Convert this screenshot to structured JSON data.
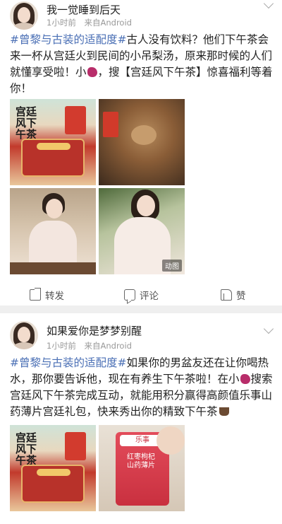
{
  "posts": [
    {
      "username": "我一觉睡到后天",
      "time": "1小时前",
      "source": "来自Android",
      "text": {
        "hashtag": "#曾黎与古装的适配度#",
        "line_a": "古人没有饮料？他们下午茶会来一杯从宫廷火到民间的小吊梨汤，原来那时候的人们就懂享受啦！小",
        "line_b": "，搜【宫廷风下午茶】惊喜福利等着你！"
      },
      "images": [
        {
          "kind": "poster",
          "caption": "宫廷风下午茶"
        },
        {
          "kind": "teaset"
        },
        {
          "kind": "woman"
        },
        {
          "kind": "woman2",
          "badge": "动图"
        }
      ],
      "actions": {
        "repost": "转发",
        "comment": "评论",
        "like": "赞"
      }
    },
    {
      "username": "如果爱你是梦梦别醒",
      "time": "1小时前",
      "source": "来自Android",
      "text": {
        "hashtag": "#曾黎与古装的适配度#",
        "line_a": "如果你的男盆友还在让你喝热水，那你要告诉他，现在有养生下午茶啦！在小",
        "line_b": "搜索宫廷风下午茶完成互动，就能用积分赢得高颜值乐事山药薄片宫廷礼包，快来秀出你的精致下午茶"
      },
      "images": [
        {
          "kind": "poster",
          "caption": "宫廷风下午茶"
        },
        {
          "kind": "snackbag",
          "logo": "乐事",
          "label": "红枣枸杞山药薄片"
        }
      ]
    }
  ],
  "colors": {
    "hashtag": "#4a6fb5",
    "meta": "#999999",
    "divider": "#efefef"
  },
  "icons": [
    "chevron-down-icon",
    "repost-icon",
    "comment-icon",
    "like-icon",
    "sweet-potato-emoji",
    "coffee-emoji"
  ]
}
